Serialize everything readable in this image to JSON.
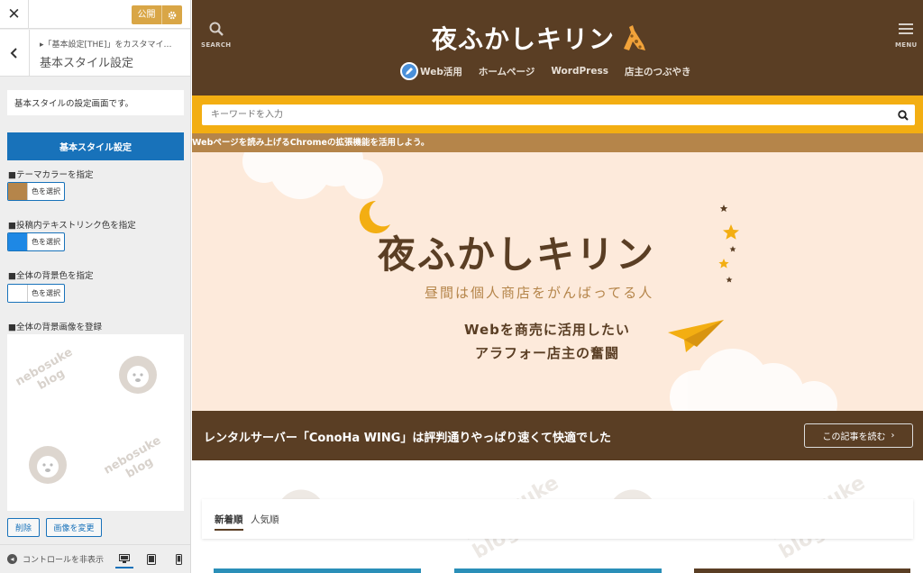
{
  "customizer": {
    "close_icon": "close-icon",
    "publish_label": "公開",
    "breadcrumb": "▸「基本設定[THE]」をカスタマイ…",
    "section_title": "基本スタイル設定",
    "description": "基本スタイルの設定画面です。",
    "heading": "基本スタイル設定",
    "controls": {
      "theme_color": {
        "label": "■テーマカラーを指定",
        "button": "色を選択",
        "color": "#b5854a"
      },
      "link_color": {
        "label": "■投稿内テキストリンク色を指定",
        "button": "色を選択",
        "color": "#1e88e5"
      },
      "bg_color": {
        "label": "■全体の背景色を指定",
        "button": "色を選択",
        "color": "#ffffff"
      },
      "bg_image": {
        "label": "■全体の背景画像を登録",
        "watermark": [
          "nebosuke",
          "blog"
        ]
      }
    },
    "remove_label": "削除",
    "change_image_label": "画像を変更",
    "hide_controls_label": "コントロールを非表示",
    "devices": [
      "desktop-icon",
      "tablet-icon",
      "mobile-icon"
    ]
  },
  "site": {
    "search_caption": "SEARCH",
    "menu_caption": "MENU",
    "logo_text": "夜ふかしキリン",
    "nav": [
      "Web活用",
      "ホームページ",
      "WordPress",
      "店主のつぶやき"
    ],
    "search_placeholder": "キーワードを入力",
    "notice": "Webページを読み上げるChromeの拡張機能を活用しよう。",
    "hero": {
      "title": "夜ふかしキリン",
      "subtitle": "昼間は個人商店をがんばってる人",
      "tagline1": "Webを商売に活用したい",
      "tagline2": "アラフォー店主の奮闘"
    },
    "featured": {
      "text": "レンタルサーバー「ConoHa WING」は評判通りやっぱり速くて快適でした",
      "button": "この記事を読む"
    },
    "sort_tabs": [
      "新着順",
      "人気順"
    ],
    "watermark": [
      "nebosuke",
      "blog"
    ],
    "colors": {
      "header": "#5a3e24",
      "accent": "#f3ae12",
      "notice": "#b5854a",
      "hero_bg": "#fdeadb"
    }
  }
}
